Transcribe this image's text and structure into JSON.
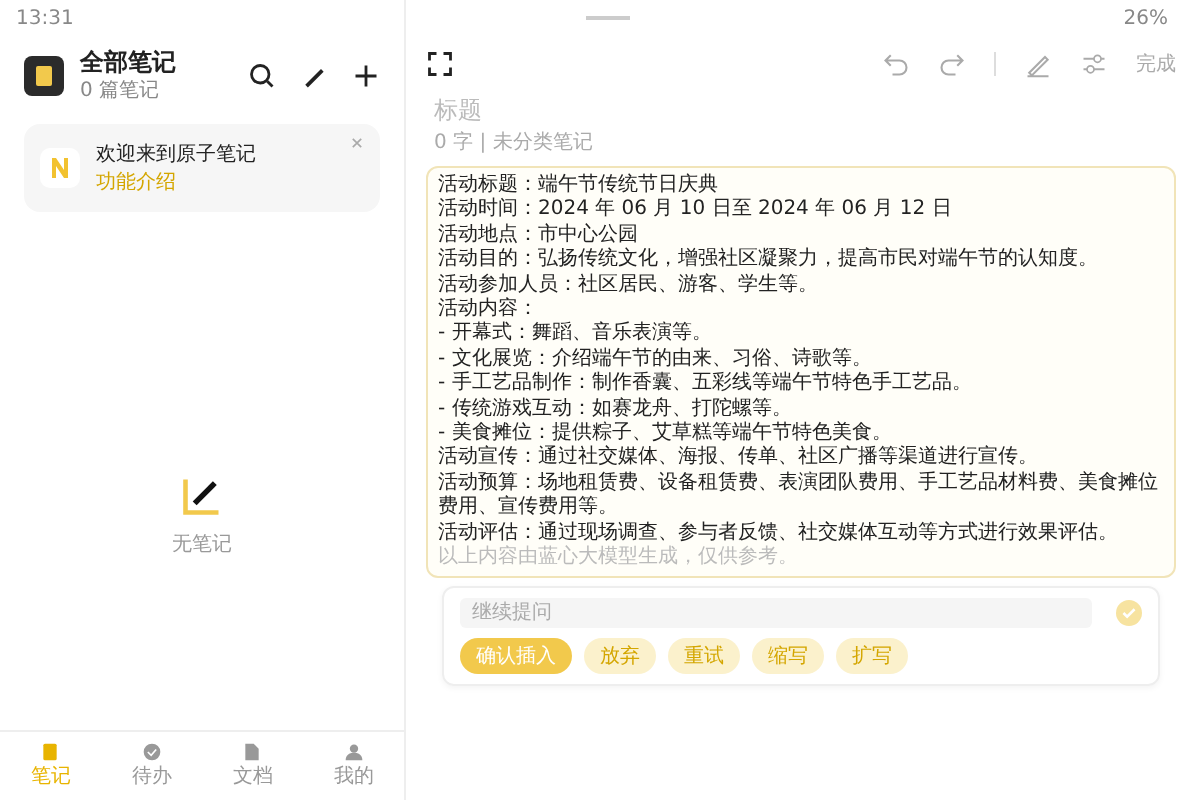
{
  "status_bar": {
    "time": "13:31",
    "battery": "26%"
  },
  "sidebar": {
    "title": "全部笔记",
    "count": "0 篇笔记",
    "banner": {
      "title": "欢迎来到原子笔记",
      "link": "功能介绍"
    },
    "empty_text": "无笔记",
    "nav": [
      {
        "label": "笔记",
        "selected": true
      },
      {
        "label": "待办",
        "selected": false
      },
      {
        "label": "文档",
        "selected": false
      },
      {
        "label": "我的",
        "selected": false
      }
    ]
  },
  "editor": {
    "done": "完成",
    "title_placeholder": "标题",
    "meta": "0 字 | 未分类笔记",
    "lines": [
      "活动标题：端午节传统节日庆典",
      "活动时间：2024 年 06 月 10 日至 2024 年 06 月 12 日",
      "活动地点：市中心公园",
      "活动目的：弘扬传统文化，增强社区凝聚力，提高市民对端午节的认知度。",
      "活动参加人员：社区居民、游客、学生等。",
      "活动内容：",
      "- 开幕式：舞蹈、音乐表演等。",
      "- 文化展览：介绍端午节的由来、习俗、诗歌等。",
      "- 手工艺品制作：制作香囊、五彩线等端午节特色手工艺品。",
      "- 传统游戏互动：如赛龙舟、打陀螺等。",
      "- 美食摊位：提供粽子、艾草糕等端午节特色美食。",
      "活动宣传：通过社交媒体、海报、传单、社区广播等渠道进行宣传。",
      "活动预算：场地租赁费、设备租赁费、表演团队费用、手工艺品材料费、美食摊位费用、宣传费用等。",
      "活动评估：通过现场调查、参与者反馈、社交媒体互动等方式进行效果评估。"
    ],
    "disclaimer": "以上内容由蓝心大模型生成，仅供参考。",
    "ask_placeholder": "继续提问",
    "actions": [
      {
        "label": "确认插入",
        "kind": "primary"
      },
      {
        "label": "放弃",
        "kind": "secondary"
      },
      {
        "label": "重试",
        "kind": "secondary"
      },
      {
        "label": "缩写",
        "kind": "secondary"
      },
      {
        "label": "扩写",
        "kind": "secondary"
      }
    ]
  }
}
